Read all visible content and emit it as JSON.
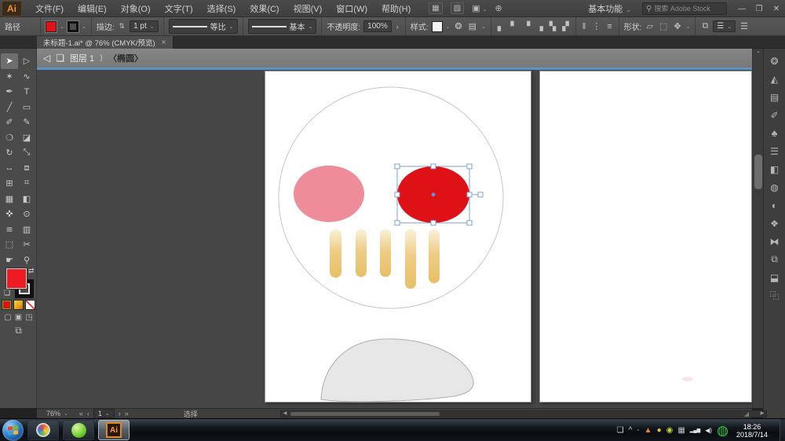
{
  "window": {
    "logo": "Ai",
    "minimize": "—",
    "restore": "❐",
    "close": "✕"
  },
  "menu_bar": {
    "items": [
      {
        "name": "menu-file",
        "label": "文件(F)"
      },
      {
        "name": "menu-edit",
        "label": "编辑(E)"
      },
      {
        "name": "menu-object",
        "label": "对象(O)"
      },
      {
        "name": "menu-type",
        "label": "文字(T)"
      },
      {
        "name": "menu-select",
        "label": "选择(S)"
      },
      {
        "name": "menu-effect",
        "label": "效果(C)"
      },
      {
        "name": "menu-view",
        "label": "视图(V)"
      },
      {
        "name": "menu-window",
        "label": "窗口(W)"
      },
      {
        "name": "menu-help",
        "label": "帮助(H)"
      }
    ],
    "workspace_switcher": "基本功能",
    "search_placeholder": "搜索 Adobe Stock"
  },
  "control_bar": {
    "object_type": "路径",
    "stroke_label": "描边:",
    "stroke_width": "1 pt",
    "profile_value": "等比",
    "brush_value": "基本",
    "opacity_label": "不透明度:",
    "opacity_value": "100%",
    "style_label": "样式:",
    "shape_label": "形状:"
  },
  "document_tabs": {
    "active_tab": "未标题-1.ai* @ 76% (CMYK/预览)",
    "close_glyph": "×"
  },
  "breadcrumb_bar": {
    "layer": "图层 1",
    "separator": "⟩",
    "item": "〈椭圆〉"
  },
  "status_bar": {
    "zoom": "76%",
    "artboard_number": "1",
    "tool_status": "选择"
  },
  "taskbar": {
    "ai_label": "Ai",
    "time": "18:26",
    "date": "2018/7/14"
  },
  "colors": {
    "fill_red": "#dd1116",
    "pink": "#ef8c99",
    "selection_blue": "#7aa0d4",
    "selection_dot": "#6b8fd0",
    "bar_top": "#faf1d9",
    "bar_mid": "#eecd86",
    "bar_bottom": "#e8bf66",
    "blob_fill": "#e7e7e7",
    "blob_stroke": "#aeaeae",
    "circle_stroke": "#c5c5cd"
  },
  "icons": {
    "caret": "⌄",
    "caret_right": "›",
    "spinner": "⇅",
    "search": "⚲",
    "bridge": "▦",
    "extensions": "▨",
    "arrange_docs": "▣",
    "services": "⊕",
    "recolor": "❂",
    "doc_setup": "▤",
    "menu_lines": "☰",
    "align1": "▖",
    "align2": "▘",
    "align3": "▝",
    "align4": "▗",
    "align5": "▚",
    "align6": "▞",
    "dist1": "‖",
    "dist2": "⋮",
    "dist3": "≡",
    "shape1": "▱",
    "shape2": "⬚",
    "transform": "✥",
    "isolate_ic": "⧉",
    "iso_back": "◁",
    "iso_layers": "❏",
    "first": "«",
    "prev": "‹",
    "next": "›",
    "last": "»",
    "up_arrow": "⌃",
    "swap": "⇄",
    "default_swatches": "❏",
    "grip": "◢"
  },
  "tools": [
    {
      "name": "selection-tool",
      "glyph": "➤",
      "selected": true
    },
    {
      "name": "direct-selection-tool",
      "glyph": "▷"
    },
    {
      "name": "magic-wand-tool",
      "glyph": "✶"
    },
    {
      "name": "lasso-tool",
      "glyph": "∿"
    },
    {
      "name": "pen-tool",
      "glyph": "✒"
    },
    {
      "name": "type-tool",
      "glyph": "T"
    },
    {
      "name": "line-segment-tool",
      "glyph": "╱"
    },
    {
      "name": "rectangle-tool",
      "glyph": "▭"
    },
    {
      "name": "paintbrush-tool",
      "glyph": "✐"
    },
    {
      "name": "pencil-tool",
      "glyph": "✎"
    },
    {
      "name": "blob-brush-tool",
      "glyph": "❍"
    },
    {
      "name": "eraser-tool",
      "glyph": "◪"
    },
    {
      "name": "rotate-tool",
      "glyph": "↻"
    },
    {
      "name": "scale-tool",
      "glyph": "⤡"
    },
    {
      "name": "width-tool",
      "glyph": "↔"
    },
    {
      "name": "free-transform-tool",
      "glyph": "⧈"
    },
    {
      "name": "shape-builder-tool",
      "glyph": "⊞"
    },
    {
      "name": "perspective-grid-tool",
      "glyph": "⌗"
    },
    {
      "name": "mesh-tool",
      "glyph": "▦"
    },
    {
      "name": "gradient-tool",
      "glyph": "◧"
    },
    {
      "name": "eyedropper-tool",
      "glyph": "✜"
    },
    {
      "name": "blend-tool",
      "glyph": "⊙"
    },
    {
      "name": "symbol-sprayer-tool",
      "glyph": "≋"
    },
    {
      "name": "column-graph-tool",
      "glyph": "▥"
    },
    {
      "name": "artboard-tool",
      "glyph": "⬚"
    },
    {
      "name": "slice-tool",
      "glyph": "✂"
    },
    {
      "name": "hand-tool",
      "glyph": "☛"
    },
    {
      "name": "zoom-tool",
      "glyph": "⚲"
    }
  ],
  "panel_dock": [
    {
      "name": "color-panel-icon",
      "glyph": "❂"
    },
    {
      "name": "color-guide-panel-icon",
      "glyph": "◭"
    },
    {
      "name": "swatches-panel-icon",
      "glyph": "▤"
    },
    {
      "name": "brushes-panel-icon",
      "glyph": "✐"
    },
    {
      "name": "symbols-panel-icon",
      "glyph": "♣"
    },
    {
      "name": "stroke-panel-icon",
      "glyph": "☰"
    },
    {
      "name": "gradient-panel-icon",
      "glyph": "◧"
    },
    {
      "name": "transparency-panel-icon",
      "glyph": "◍"
    },
    {
      "name": "appearance-panel-icon",
      "glyph": "◐"
    },
    {
      "name": "graphic-styles-panel-icon",
      "glyph": "❖"
    },
    {
      "name": "links-panel-icon",
      "glyph": "⧓"
    },
    {
      "name": "export-panel-icon",
      "glyph": "⧉"
    },
    {
      "name": "layers-panel-icon",
      "glyph": "⬓"
    },
    {
      "name": "artboards-panel-icon",
      "glyph": "⿻"
    }
  ],
  "tray_icons": [
    {
      "name": "folder-icon",
      "glyph": "❏",
      "color": "#d8dce0"
    },
    {
      "name": "hidden-icons-caret",
      "glyph": "^",
      "color": "#cfd3d6"
    },
    {
      "name": "tray-dash-icon",
      "glyph": "-",
      "color": "#9aa0a6"
    },
    {
      "name": "flame-app-icon",
      "glyph": "▲",
      "color": "#e8822a"
    },
    {
      "name": "yellow-dot-icon",
      "glyph": "●",
      "color": "#e3c52f"
    },
    {
      "name": "optimizer-icon",
      "glyph": "◉",
      "color": "#cdd32f"
    },
    {
      "name": "ime-keyboard-icon",
      "glyph": "▦",
      "color": "#b9c0c6"
    },
    {
      "name": "network-signal-icon",
      "glyph": "▂▄▆",
      "color": "#dfe3e6",
      "size": "6px"
    },
    {
      "name": "volume-icon",
      "glyph": "◀)",
      "color": "#dfe3e6",
      "size": "8px"
    },
    {
      "name": "antivirus-360-icon",
      "glyph": "◍",
      "color": "#35c24a",
      "size": "17px"
    }
  ]
}
